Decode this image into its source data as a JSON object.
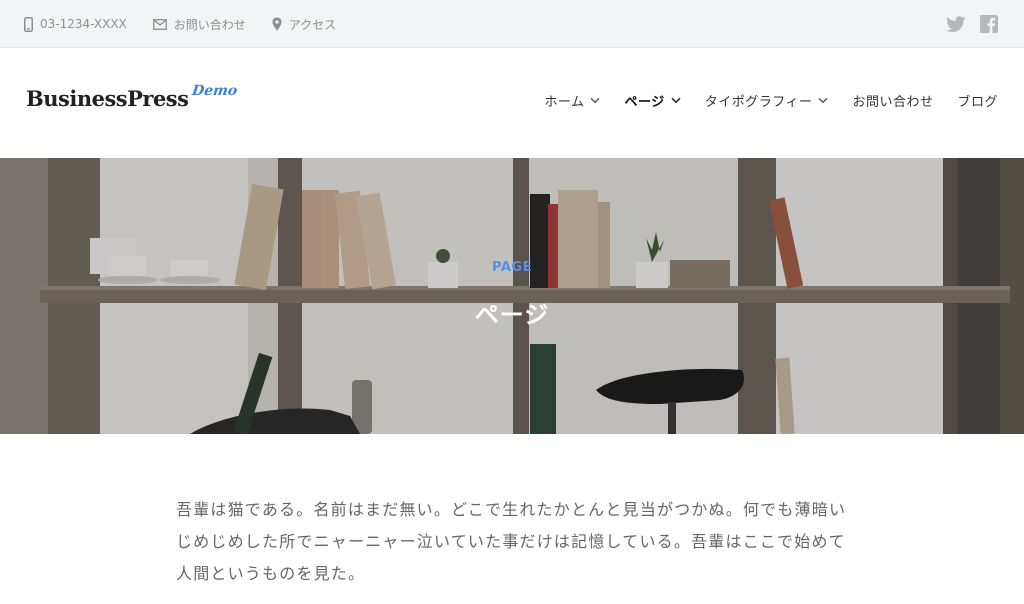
{
  "topbar": {
    "phone": "03-1234-XXXX",
    "contact": "お問い合わせ",
    "access": "アクセス",
    "phone_icon": "phone-icon",
    "mail_icon": "mail-icon",
    "pin_icon": "map-pin-icon",
    "social": [
      "twitter-icon",
      "facebook-icon"
    ]
  },
  "header": {
    "logo": "BusinessPress",
    "logo_sub": "Demo",
    "nav": [
      {
        "label": "ホーム",
        "dropdown": true
      },
      {
        "label": "ページ",
        "dropdown": true,
        "active": true
      },
      {
        "label": "タイポグラフィー",
        "dropdown": true
      },
      {
        "label": "お問い合わせ",
        "dropdown": false
      },
      {
        "label": "ブログ",
        "dropdown": false
      }
    ]
  },
  "hero": {
    "subtitle": "PAGE",
    "title": "ページ"
  },
  "content": {
    "body": "吾輩は猫である。名前はまだ無い。どこで生れたかとんと見当がつかぬ。何でも薄暗いじめじめした所でニャーニャー泣いていた事だけは記憶している。吾輩はここで始めて人間というものを見た。"
  },
  "colors": {
    "accent": "#3d7fd4",
    "topbar_bg": "#f3f4f5",
    "text_muted": "#8a8f94"
  }
}
